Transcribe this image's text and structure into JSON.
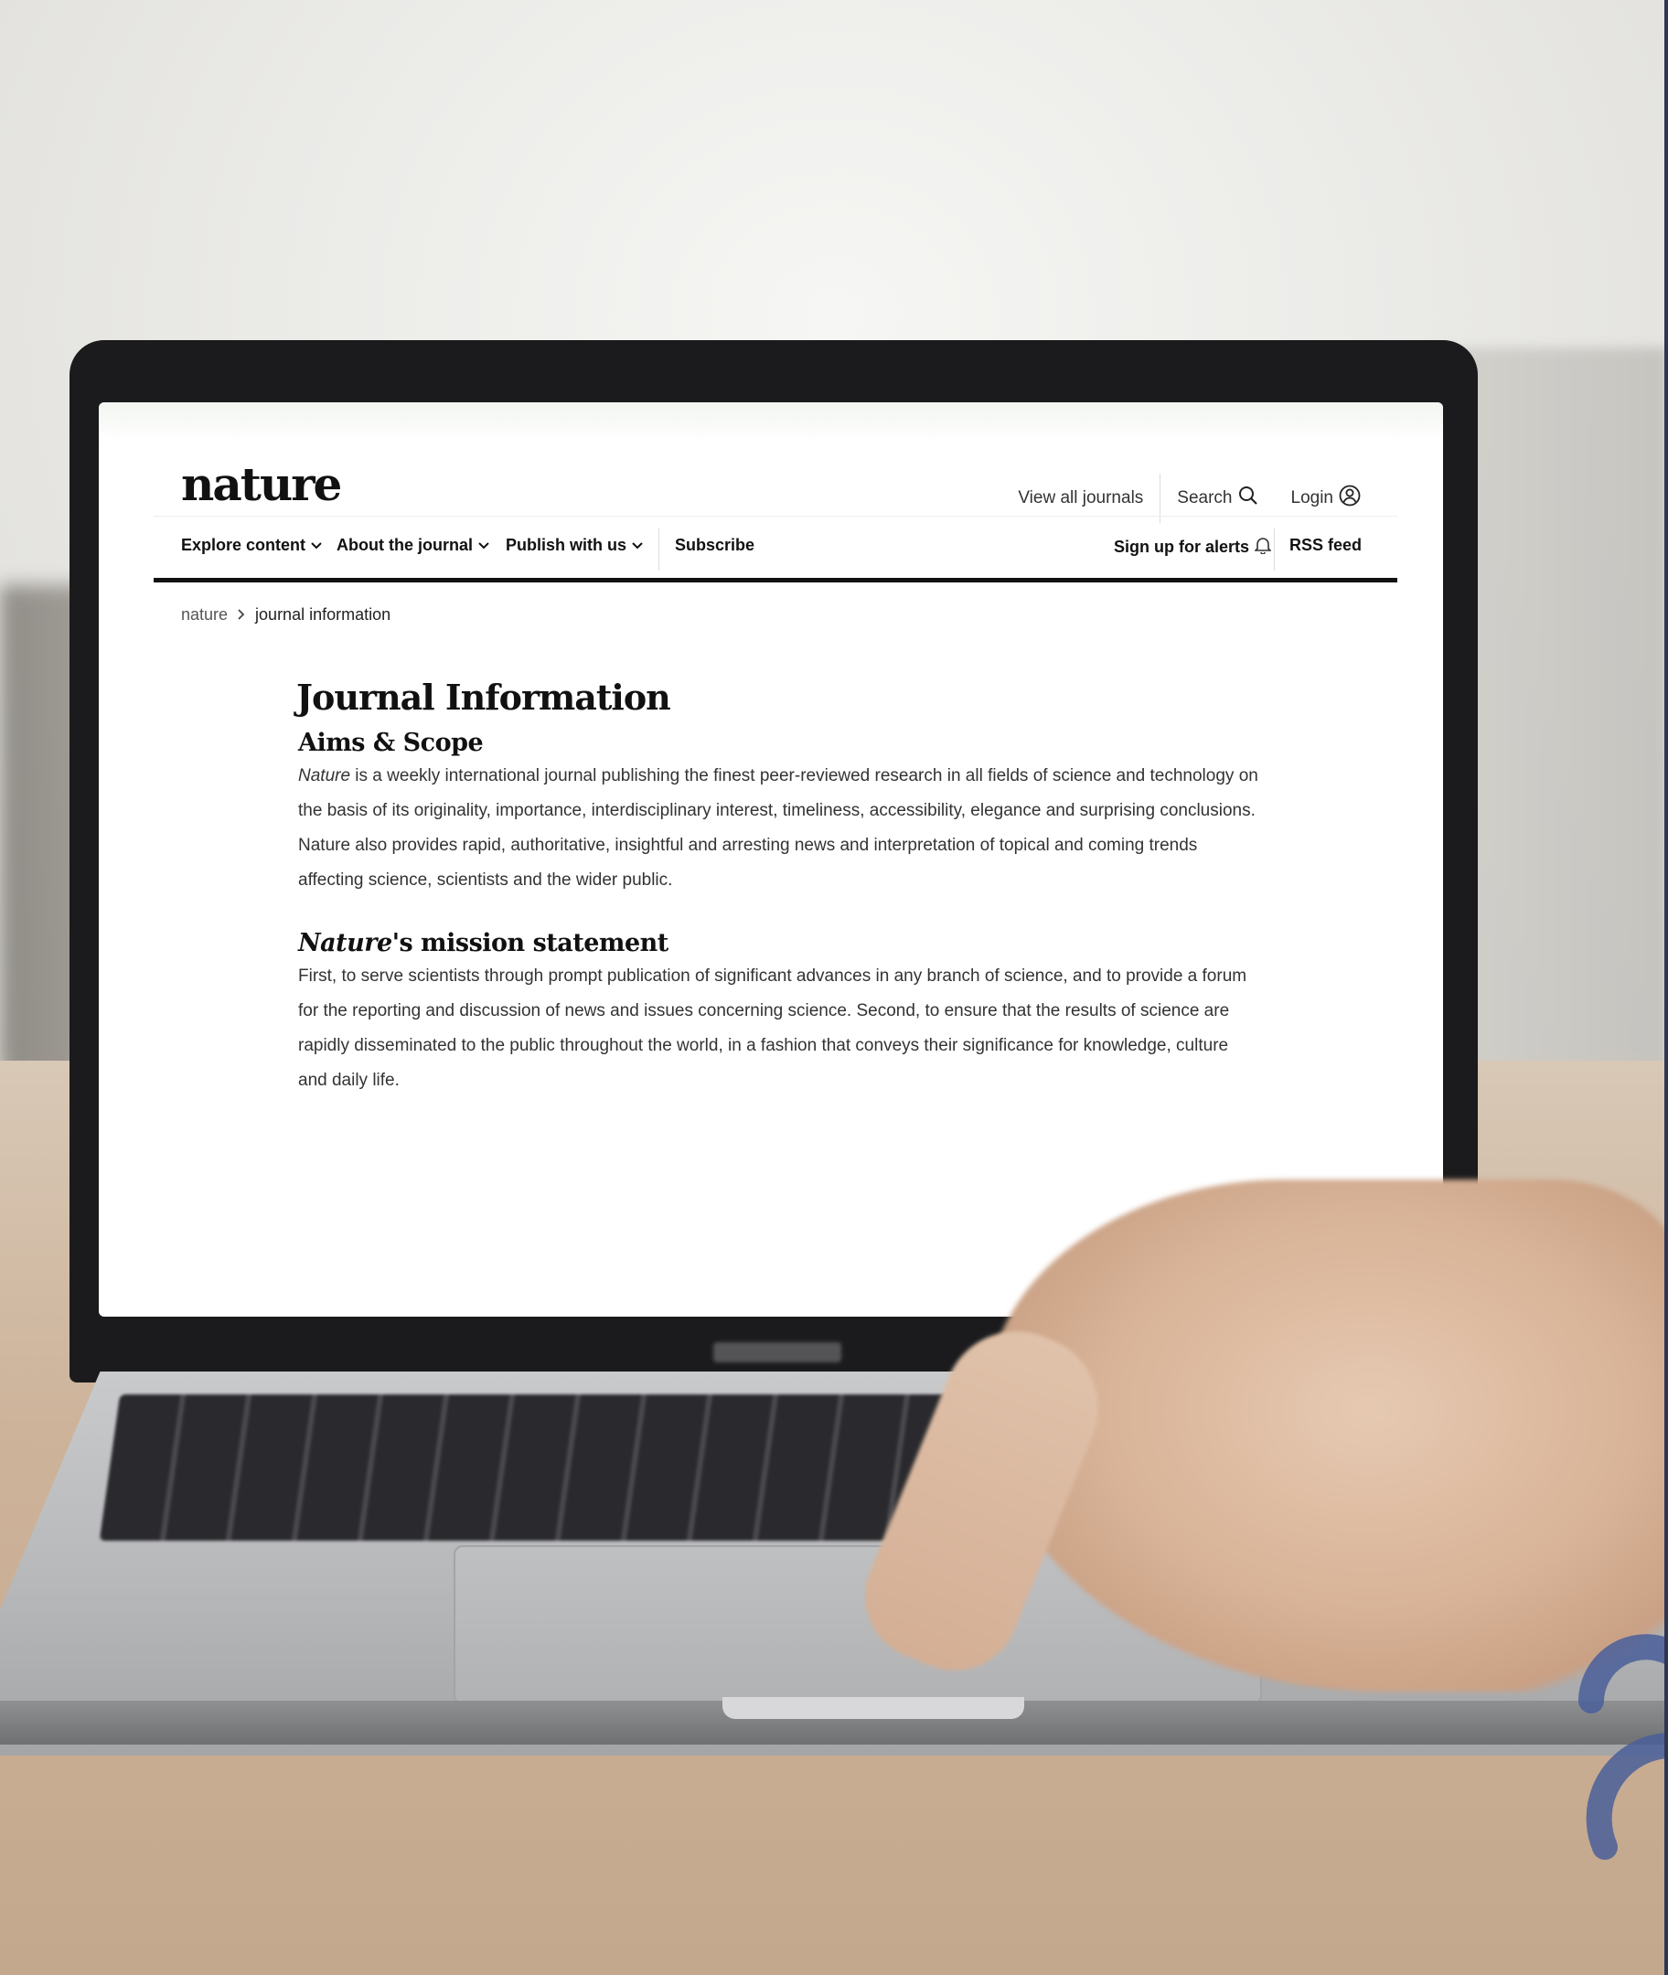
{
  "site": {
    "logo": "nature",
    "top_links": {
      "view_all_journals": "View all journals",
      "search": "Search",
      "login": "Login"
    },
    "nav": {
      "explore_content": "Explore content",
      "about_the_journal": "About the journal",
      "publish_with_us": "Publish with us",
      "subscribe": "Subscribe",
      "sign_up_for_alerts": "Sign up for alerts",
      "rss_feed": "RSS feed"
    },
    "breadcrumb": {
      "root": "nature",
      "current": "journal information"
    }
  },
  "article": {
    "title": "Journal Information",
    "aims_heading": "Aims & Scope",
    "aims_lead_italic": "Nature",
    "aims_body": " is a weekly international journal publishing the finest peer-reviewed research in all fields of science and technology on the basis of its originality, importance, interdisciplinary interest, timeliness, accessibility, elegance and surprising conclusions. Nature also provides rapid, authoritative, insightful and arresting news and interpretation of topical and coming trends affecting science, scientists and the wider public.",
    "mission_heading_italic": "Nature",
    "mission_heading_rest": "'s mission statement",
    "mission_body": "First, to serve scientists through prompt publication of significant advances in any branch of science, and to provide a forum for the reporting and discussion of news and issues concerning science. Second, to ensure that the results of science are rapidly disseminated to the public throughout the world, in a fashion that conveys their significance for knowledge, culture and daily life."
  },
  "icons": {
    "search": "search-icon",
    "login": "user-circle-icon",
    "chevron": "chevron-down-icon",
    "bell": "bell-icon",
    "breadcrumb_separator": "chevron-right-icon"
  },
  "colors": {
    "nav_rule": "#111111",
    "corner_logo": "#4a5f9a"
  }
}
